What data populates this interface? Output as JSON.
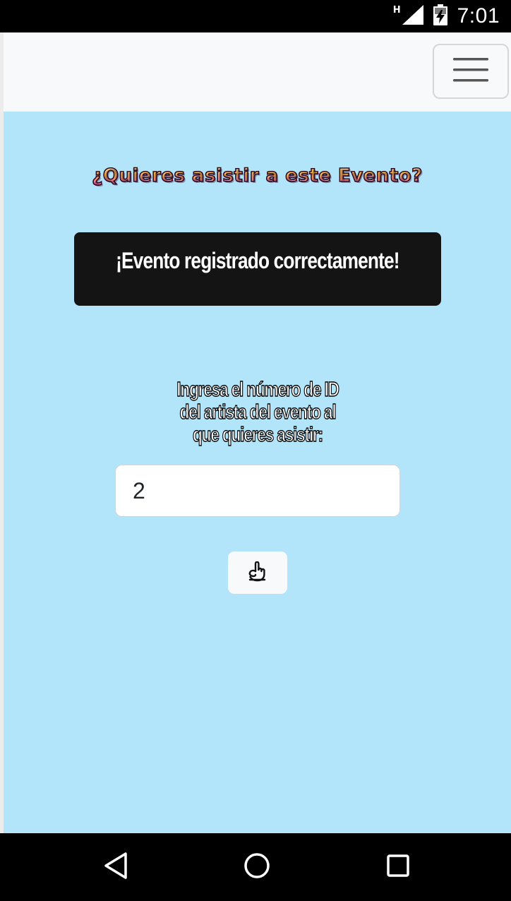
{
  "status_bar": {
    "network_type": "H",
    "time": "7:01"
  },
  "navbar": {
    "toggler_icon": "hamburger-menu-icon"
  },
  "main": {
    "question_title": "¿Quieres asistir a este Evento?",
    "success_message": "¡Evento registrado correctamente!",
    "instruction": "Ingresa el número de ID del artista del evento al que quieres asistir:",
    "artist_id_value": "2",
    "submit_icon": "hand-pointing-icon"
  },
  "nav_bar": {
    "back_icon": "back-triangle-icon",
    "home_icon": "home-circle-icon",
    "recents_icon": "recents-square-icon"
  },
  "colors": {
    "background": "#b3e5fa",
    "alert_background": "#141414",
    "navbar_background": "#f8f9fa"
  }
}
